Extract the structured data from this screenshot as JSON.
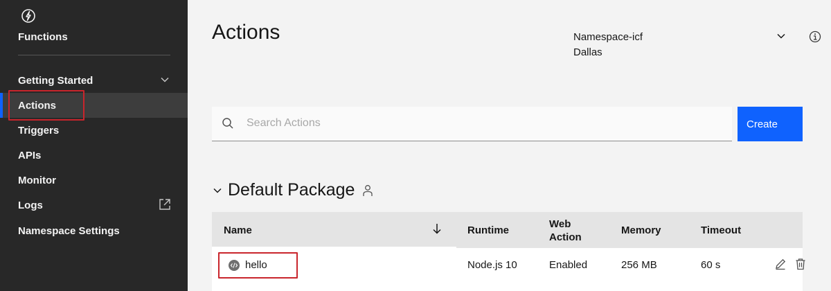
{
  "sidebar": {
    "brand": "Functions",
    "items": [
      {
        "label": "Getting Started",
        "icon": "chevron-down-icon"
      },
      {
        "label": "Actions",
        "active": true
      },
      {
        "label": "Triggers"
      },
      {
        "label": "APIs"
      },
      {
        "label": "Monitor"
      },
      {
        "label": "Logs",
        "icon": "launch-icon"
      },
      {
        "label": "Namespace Settings"
      }
    ]
  },
  "header": {
    "title": "Actions",
    "namespace": "Namespace-icf",
    "region": "Dallas"
  },
  "search": {
    "placeholder": "Search Actions"
  },
  "create_button": "Create",
  "package": {
    "title": "Default Package"
  },
  "table": {
    "columns": {
      "name": "Name",
      "runtime": "Runtime",
      "web_action_line1": "Web",
      "web_action_line2": "Action",
      "memory": "Memory",
      "timeout": "Timeout"
    },
    "rows": [
      {
        "name": "hello",
        "runtime": "Node.js 10",
        "web_action": "Enabled",
        "memory": "256 MB",
        "timeout": "60 s"
      }
    ]
  },
  "colors": {
    "sidebar_bg": "#282828",
    "accent": "#0f62fe",
    "highlight": "#c9252c"
  }
}
